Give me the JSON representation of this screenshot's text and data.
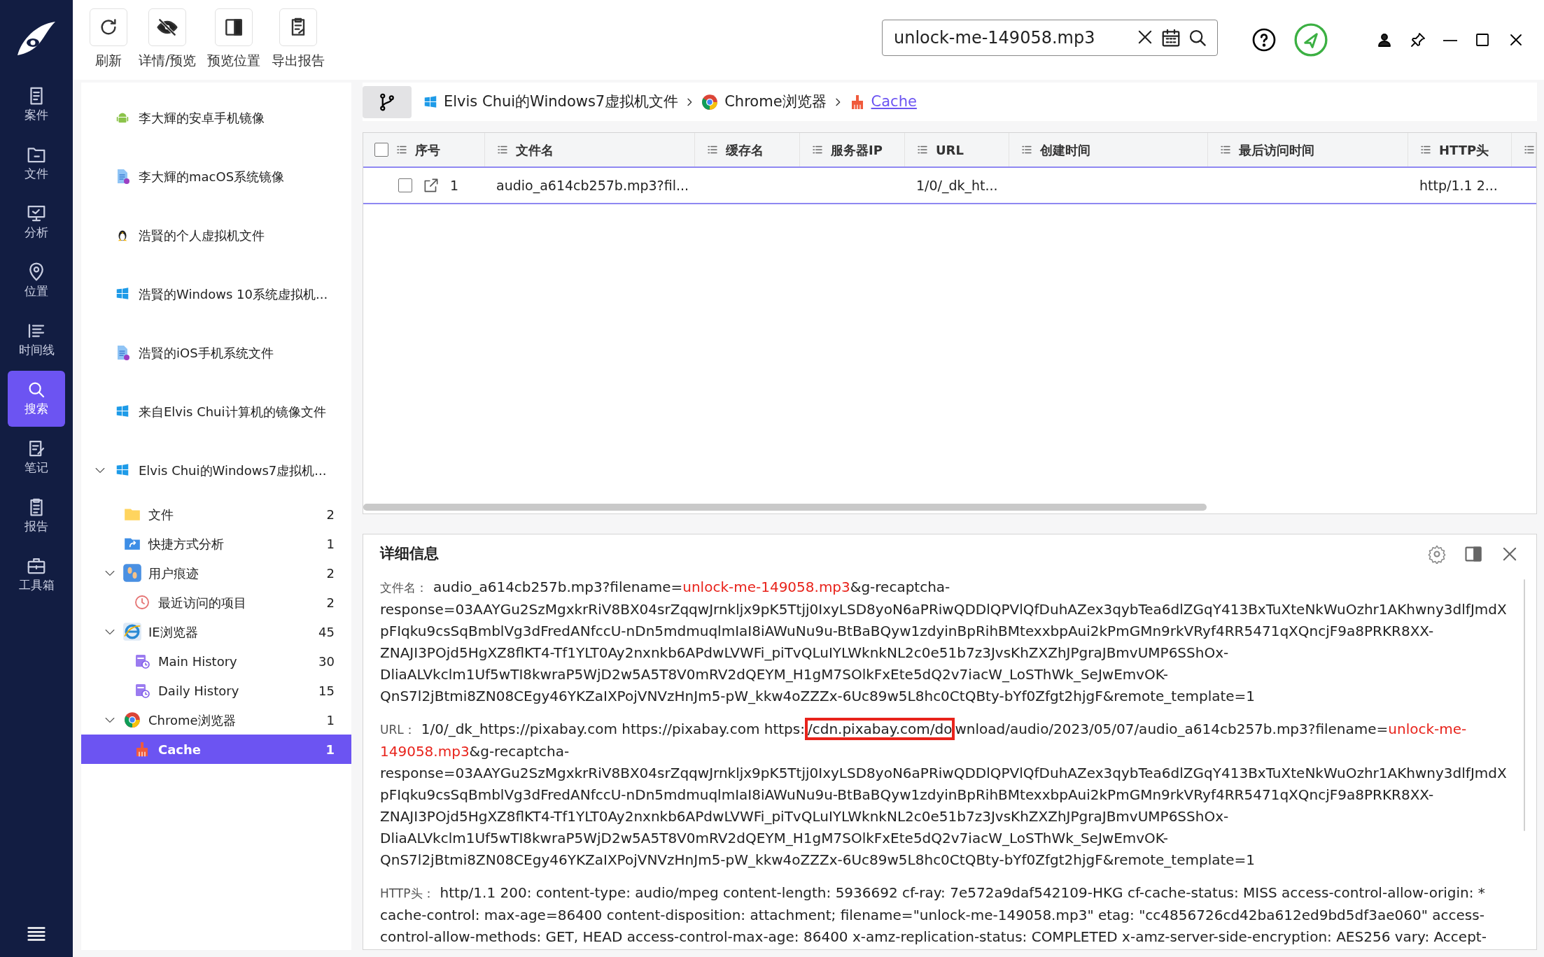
{
  "toolbar": [
    {
      "label": "刷新"
    },
    {
      "label": "详情/预览"
    },
    {
      "label": "预览位置"
    },
    {
      "label": "导出报告"
    }
  ],
  "search": {
    "value": "unlock-me-149058.mp3"
  },
  "nav_rail": [
    {
      "label": "案件",
      "selected": false
    },
    {
      "label": "文件",
      "selected": false
    },
    {
      "label": "分析",
      "selected": false
    },
    {
      "label": "位置",
      "selected": false
    },
    {
      "label": "时间线",
      "selected": false
    },
    {
      "label": "搜索",
      "selected": true
    },
    {
      "label": "笔记",
      "selected": false
    },
    {
      "label": "报告",
      "selected": false
    },
    {
      "label": "工具箱",
      "selected": false
    }
  ],
  "tree": [
    {
      "label": "李大輝的安卓手机镜像",
      "kind": "android",
      "selected": false
    },
    {
      "label": "李大輝的macOS系统镜像",
      "kind": "doc",
      "selected": false
    },
    {
      "label": "浩賢的个人虚拟机文件",
      "kind": "linux",
      "selected": false
    },
    {
      "label": "浩賢的Windows 10系统虚拟机...",
      "kind": "windows",
      "selected": false
    },
    {
      "label": "浩賢的iOS手机系统文件",
      "kind": "doc",
      "selected": false
    },
    {
      "label": "来自Elvis Chui计算机的镜像文件",
      "kind": "windows",
      "selected": false
    },
    {
      "label": "Elvis Chui的Windows7虚拟机...",
      "kind": "windows",
      "selected": false,
      "expanded": true,
      "children": [
        {
          "label": "文件",
          "kind": "folder",
          "count": "2",
          "selected": false
        },
        {
          "label": "快捷方式分析",
          "kind": "shortcut",
          "count": "1",
          "selected": false
        },
        {
          "label": "用户痕迹",
          "kind": "trace",
          "count": "2",
          "selected": false,
          "expanded": true,
          "children": [
            {
              "label": "最近访问的项目",
              "kind": "clock",
              "count": "2",
              "selected": false
            }
          ]
        },
        {
          "label": "IE浏览器",
          "kind": "ie",
          "count": "45",
          "selected": false,
          "expanded": true,
          "children": [
            {
              "label": "Main History",
              "kind": "history",
              "count": "30",
              "selected": false
            },
            {
              "label": "Daily History",
              "kind": "history",
              "count": "15",
              "selected": false
            }
          ]
        },
        {
          "label": "Chrome浏览器",
          "kind": "chrome",
          "count": "1",
          "selected": false,
          "expanded": true,
          "children": [
            {
              "label": "Cache",
              "kind": "cache",
              "count": "1",
              "selected": true
            }
          ]
        }
      ]
    }
  ],
  "breadcrumb": [
    {
      "label": "Elvis Chui的Windows7虚拟机文件",
      "kind": "windows",
      "current": false
    },
    {
      "label": "Chrome浏览器",
      "kind": "chrome",
      "current": false
    },
    {
      "label": "Cache",
      "kind": "cache",
      "current": true
    }
  ],
  "table": {
    "select_all_checked": false,
    "columns": [
      "序号",
      "文件名",
      "缓存名",
      "服务器IP",
      "URL",
      "创建时间",
      "最后访问时间",
      "HTTP头"
    ],
    "rows": [
      {
        "checked": false,
        "selected": true,
        "cells": [
          "1",
          "audio_a614cb257b.mp3?fil...",
          "",
          "",
          "1/0/_dk_ht...",
          "",
          "",
          "http/1.1 2..."
        ]
      }
    ]
  },
  "detail": {
    "title": "详细信息",
    "fields": [
      {
        "label": "文件名：",
        "segments": [
          {
            "text": "audio_a614cb257b.mp3?filename=",
            "kind": "plain"
          },
          {
            "text": "unlock-me-149058.mp3",
            "kind": "match"
          },
          {
            "text": "&g-recaptcha-response=03AAYGu2SzMgxkrRiV8BX04srZqqwJrnkljx9pK5Ttjj0IxyLSD8yoN6aPRiwQDDlQPVlQfDuhAZex3qybTea6dlZGqY413BxTuXteNkWuOzhr1AKhwny3dlfJmdXpFIqku9csSqBmblVg3dFredANfccU-nDn5mdmuqlmIaI8iAWuNu9u-BtBaBQyw1zdyinBpRihBMtexxbpAui2kPmGMn9rkVRyf4RR5471qXQncjF9a8PRKR8XX-ZNAJI3POjd5HgXZ8flKT4-Tf1YLT0Ay2nxnkb6APdwLVWFi_piTvQLuIYLWknkNL2c0e51b7z3JvsKhZXZhJPgraJBmvUMP6SShOx-DliaALVkclm1Uf5wTI8kwraP5WjD2w5A5T8V0mRV2dQEYM_H1gM7SOlkFxEte5dQ2v7iacW_LoSThWk_SeJwEmvOK-QnS7l2jBtmi8ZN08CEgy46YKZaIXPojVNVzHnJm5-pW_kkw4oZZZx-6Uc89w5L8hc0CtQBty-bYf0Zfgt2hjgF&remote_template=1",
            "kind": "plain"
          }
        ]
      },
      {
        "label": "URL：",
        "segments": [
          {
            "text": "1/0/_dk_https://pixabay.com https://pixabay.com https:",
            "kind": "plain"
          },
          {
            "text": "/cdn.pixabay.com/do",
            "kind": "boxed"
          },
          {
            "text": "wnload/audio/2023/05/07/audio_a614cb257b.mp3?filename=",
            "kind": "plain"
          },
          {
            "text": "unlock-me-149058.mp3",
            "kind": "match"
          },
          {
            "text": "&g-recaptcha-response=03AAYGu2SzMgxkrRiV8BX04srZqqwJrnkljx9pK5Ttjj0IxyLSD8yoN6aPRiwQDDlQPVlQfDuhAZex3qybTea6dlZGqY413BxTuXteNkWuOzhr1AKhwny3dlfJmdXpFIqku9csSqBmblVg3dFredANfccU-nDn5mdmuqlmIaI8iAWuNu9u-BtBaBQyw1zdyinBpRihBMtexxbpAui2kPmGMn9rkVRyf4RR5471qXQncjF9a8PRKR8XX-ZNAJI3POjd5HgXZ8flKT4-Tf1YLT0Ay2nxnkb6APdwLVWFi_piTvQLuIYLWknkNL2c0e51b7z3JvsKhZXZhJPgraJBmvUMP6SShOx-DliaALVkclm1Uf5wTI8kwraP5WjD2w5A5T8V0mRV2dQEYM_H1gM7SOlkFxEte5dQ2v7iacW_LoSThWk_SeJwEmvOK-QnS7l2jBtmi8ZN08CEgy46YKZaIXPojVNVzHnJm5-pW_kkw4oZZZx-6Uc89w5L8hc0CtQBty-bYf0Zfgt2hjgF&remote_template=1",
            "kind": "plain"
          }
        ]
      },
      {
        "label": "HTTP头：",
        "segments": [
          {
            "text": "http/1.1 200: content-type: audio/mpeg content-length: 5936692 cf-ray: 7e572a9daf542109-HKG cf-cache-status: MISS access-control-allow-origin: * cache-control: max-age=86400 content-disposition: attachment; filename=\"unlock-me-149058.mp3\" etag: \"cc4856726cd42ba612ed9bd5df3ae060\" access-control-allow-methods: GET, HEAD access-control-max-age: 86400 x-amz-replication-status: COMPLETED x-amz-server-side-encryption: AES256 vary: Accept-",
            "kind": "plain"
          }
        ]
      }
    ]
  }
}
